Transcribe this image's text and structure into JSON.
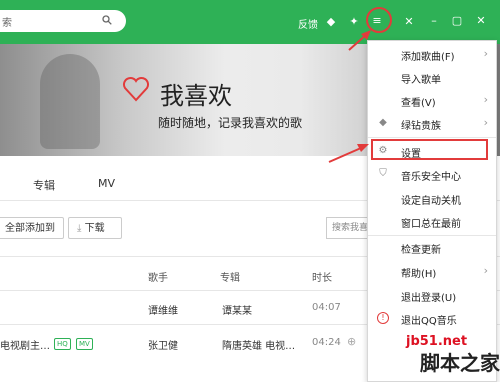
{
  "search": {
    "text": "索"
  },
  "topbar": {
    "feedback": "反馈",
    "icons": [
      "diamond-icon",
      "shirt-icon",
      "menu-icon",
      "mini-mode-icon",
      "minimize-icon",
      "maximize-icon",
      "close-icon"
    ]
  },
  "banner": {
    "title": "我喜欢",
    "subtitle": "随时随地，记录我喜欢的歌"
  },
  "tabs": [
    "专辑",
    "MV"
  ],
  "actions": {
    "add_all": "全部添加到",
    "download": "下载",
    "search_placeholder": "搜索我喜"
  },
  "table": {
    "headers": {
      "singer": "歌手",
      "album": "专辑",
      "duration": "时长"
    },
    "rows": [
      {
        "song": "",
        "singer": "谭维维",
        "album": "谭某某",
        "duration": "04:07"
      },
      {
        "song": "电视剧主…",
        "tags": [
          "HQ",
          "MV"
        ],
        "singer": "张卫健",
        "album": "隋唐英雄 电视…",
        "duration": "04:24"
      }
    ]
  },
  "menu": {
    "items": [
      {
        "label": "添加歌曲(F)",
        "icon": "",
        "arrow": "›"
      },
      {
        "label": "导入歌单",
        "icon": "",
        "arrow": ""
      },
      {
        "label": "查看(V)",
        "icon": "",
        "arrow": "›"
      },
      {
        "label": "绿钻贵族",
        "icon": "◆",
        "arrow": "›"
      },
      {
        "label": "设置",
        "icon": "⚙",
        "arrow": ""
      },
      {
        "label": "音乐安全中心",
        "icon": "⛉",
        "arrow": ""
      },
      {
        "label": "设定自动关机",
        "icon": "",
        "arrow": ""
      },
      {
        "label": "窗口总在最前",
        "icon": "",
        "arrow": ""
      },
      {
        "label": "检查更新",
        "icon": "",
        "arrow": ""
      },
      {
        "label": "帮助(H)",
        "icon": "",
        "arrow": "›"
      },
      {
        "label": "退出登录(U)",
        "icon": "",
        "arrow": ""
      },
      {
        "label": "退出QQ音乐",
        "icon": "!",
        "arrow": ""
      }
    ]
  },
  "watermark": {
    "site": "jb51.net",
    "name": "脚本之家"
  },
  "colors": {
    "accent": "#2eb156",
    "highlight": "#e23b3b"
  }
}
